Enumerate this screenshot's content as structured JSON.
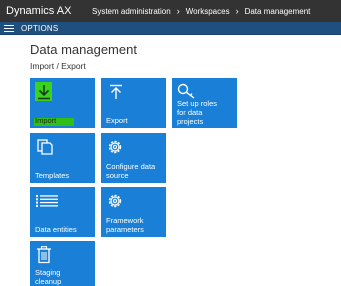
{
  "header": {
    "app_name": "Dynamics AX",
    "breadcrumbs": [
      "System administration",
      "Workspaces",
      "Data management"
    ]
  },
  "optionsbar": {
    "options_label": "OPTIONS"
  },
  "page": {
    "title": "Data management",
    "subtitle": "Import / Export"
  },
  "tiles": {
    "import": {
      "label": "Import",
      "icon": "download-icon"
    },
    "export": {
      "label": "Export",
      "icon": "upload-icon"
    },
    "setup_roles": {
      "label_lines": [
        "Set up roles",
        "for data",
        "projects"
      ],
      "icon": "key-icon"
    },
    "templates": {
      "label": "Templates",
      "icon": "templates-icon"
    },
    "configure_source": {
      "label_lines": [
        "Configure data",
        "source"
      ],
      "icon": "gear-icon"
    },
    "data_entities": {
      "label": "Data entities",
      "icon": "list-icon"
    },
    "framework_params": {
      "label_lines": [
        "Framework",
        "parameters"
      ],
      "icon": "gear-icon"
    },
    "staging_cleanup": {
      "label_lines": [
        "Staging",
        "cleanup"
      ],
      "icon": "trash-icon"
    }
  },
  "colors": {
    "topbar": "#333333",
    "optionsbar": "#1f4f7c",
    "tile": "#1a7fd6",
    "highlight": "#39d31e"
  }
}
